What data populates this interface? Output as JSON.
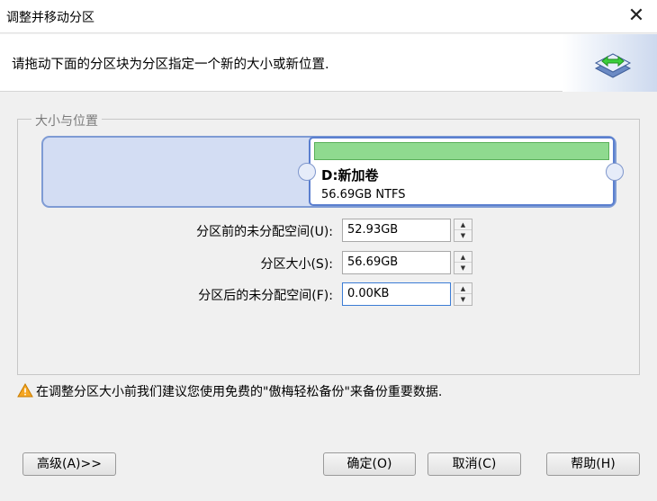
{
  "window": {
    "title": "调整并移动分区",
    "close_glyph": "✕"
  },
  "header": {
    "description": "请拖动下面的分区块为分区指定一个新的大小或新位置."
  },
  "group": {
    "legend": "大小与位置"
  },
  "partition": {
    "name": "D:新加卷",
    "info": "56.69GB NTFS",
    "fill_color": "#8fda8f"
  },
  "fields": {
    "before": {
      "label": "分区前的未分配空间(U):",
      "value": "52.93GB"
    },
    "size": {
      "label": "分区大小(S):",
      "value": "56.69GB"
    },
    "after": {
      "label": "分区后的未分配空间(F):",
      "value": "0.00KB"
    }
  },
  "warning": {
    "text": "在调整分区大小前我们建议您使用免费的\"傲梅轻松备份\"来备份重要数据.",
    "icon": "warning-triangle-icon"
  },
  "buttons": {
    "advanced": "高级(A)>>",
    "ok": "确定(O)",
    "cancel": "取消(C)",
    "help": "帮助(H)"
  },
  "spin_glyphs": {
    "up": "▲",
    "down": "▼"
  }
}
